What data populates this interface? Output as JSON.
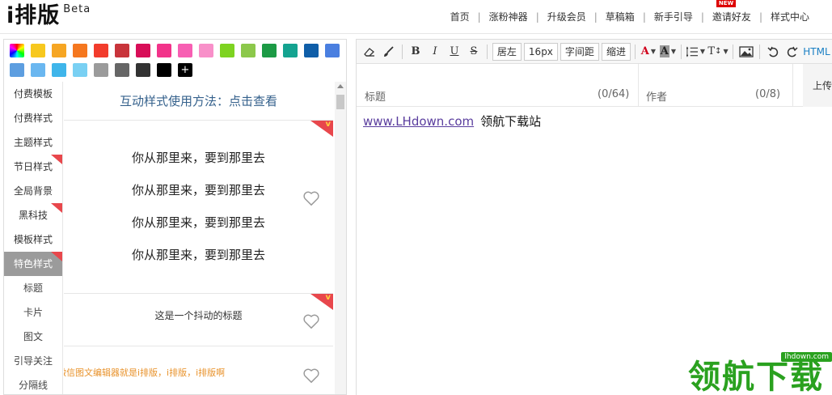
{
  "header": {
    "logo": "i排版",
    "beta": "Beta",
    "nav": [
      {
        "label": "首页"
      },
      {
        "label": "涨粉神器"
      },
      {
        "label": "升级会员"
      },
      {
        "label": "草稿箱"
      },
      {
        "label": "新手引导"
      },
      {
        "label": "邀请好友",
        "badge": "NEW"
      },
      {
        "label": "样式中心"
      }
    ]
  },
  "palette": {
    "row1": [
      "rainbow",
      "#f7c81e",
      "#f6a623",
      "#f5771f",
      "#f23c2c",
      "#c8343b",
      "#d80e58",
      "#f2338a",
      "#f75fb3",
      "#f890c9",
      "#7ed321",
      "#8cc84b",
      "#1c9a45",
      "#14a390",
      "#0f5ea8",
      "#4a7fe0"
    ],
    "row2": [
      "#5d9ee0",
      "#6ab7f0",
      "#3fb5ea",
      "#79d0f3",
      "#9b9b9b",
      "#666666",
      "#333333",
      "#000000"
    ],
    "add_label": "+"
  },
  "categories": [
    {
      "label": "付费模板",
      "flag": false,
      "active": false,
      "sub": false
    },
    {
      "label": "付费样式",
      "flag": false,
      "active": false,
      "sub": false
    },
    {
      "label": "主题样式",
      "flag": false,
      "active": false,
      "sub": false
    },
    {
      "label": "节日样式",
      "flag": true,
      "active": false,
      "sub": false
    },
    {
      "label": "全局背景",
      "flag": false,
      "active": false,
      "sub": false
    },
    {
      "label": "黑科技",
      "flag": true,
      "active": false,
      "sub": false
    },
    {
      "label": "模板样式",
      "flag": false,
      "active": false,
      "sub": false
    },
    {
      "label": "特色样式",
      "flag": true,
      "active": true,
      "sub": false
    },
    {
      "label": "标题",
      "flag": false,
      "active": false,
      "sub": true
    },
    {
      "label": "卡片",
      "flag": false,
      "active": false,
      "sub": true
    },
    {
      "label": "图文",
      "flag": false,
      "active": false,
      "sub": true
    },
    {
      "label": "引导关注",
      "flag": false,
      "active": false,
      "sub": true
    },
    {
      "label": "分隔线",
      "flag": false,
      "active": false,
      "sub": true
    }
  ],
  "templates": {
    "tip": "互动样式使用方法：点击查看",
    "card1_lines": [
      "你从那里来，要到那里去",
      "你从那里来，要到那里去",
      "你从那里来，要到那里去",
      "你从那里来，要到那里去"
    ],
    "card2_title": "这是一个抖动的标题",
    "card3_text": "微信图文编辑器就是i排版，i排版，i排版啊"
  },
  "toolbar": {
    "bold": "B",
    "italic": "I",
    "underline": "U",
    "strike": "S",
    "align": "居左",
    "font_size": "16px",
    "letter_spacing": "字间距",
    "indent": "缩进",
    "font_color": "A",
    "bg_color": "A",
    "heading": "T",
    "html": "HTML"
  },
  "meta": {
    "title_label": "标题",
    "title_count": "(0/64)",
    "author_label": "作者",
    "author_count": "(0/8)",
    "upload": "上传"
  },
  "content": {
    "link_text": "www.LHdown.com",
    "site_name": "领航下载站"
  },
  "watermark": {
    "text": "领航下载",
    "url": "lhdown.com"
  }
}
